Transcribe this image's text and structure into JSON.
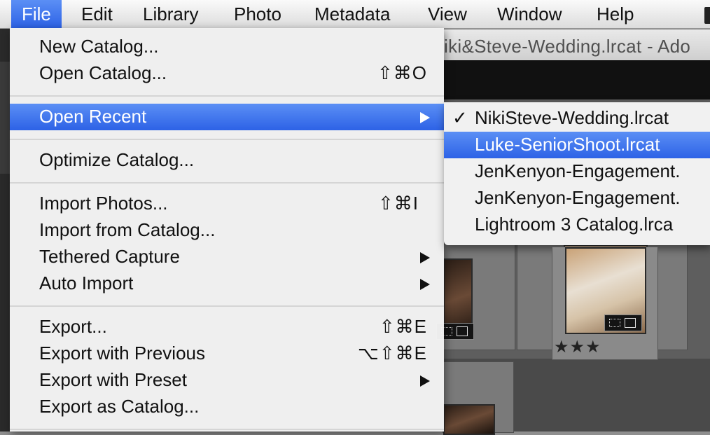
{
  "menubar": {
    "items": [
      "File",
      "Edit",
      "Library",
      "Photo",
      "Metadata",
      "View",
      "Window",
      "Help"
    ],
    "active": "File"
  },
  "window": {
    "title": "iki&Steve-Wedding.lrcat - Ado"
  },
  "file_menu": {
    "items": [
      {
        "label": "New Catalog...",
        "shortcut": ""
      },
      {
        "label": "Open Catalog...",
        "shortcut": "⇧⌘O"
      },
      {
        "label": "Open Recent",
        "submenu": true,
        "highlighted": true
      },
      {
        "label": "Optimize Catalog...",
        "shortcut": ""
      },
      {
        "label": "Import Photos...",
        "shortcut": "⇧⌘I"
      },
      {
        "label": "Import from Catalog...",
        "shortcut": ""
      },
      {
        "label": "Tethered Capture",
        "submenu": true
      },
      {
        "label": "Auto Import",
        "submenu": true
      },
      {
        "label": "Export...",
        "shortcut": "⇧⌘E"
      },
      {
        "label": "Export with Previous",
        "shortcut": "⌥⇧⌘E"
      },
      {
        "label": "Export with Preset",
        "submenu": true
      },
      {
        "label": "Export as Catalog...",
        "shortcut": ""
      }
    ]
  },
  "open_recent_submenu": {
    "check_mark": "✓",
    "items": [
      {
        "label": "NikiSteve-Wedding.lrcat",
        "checked": true
      },
      {
        "label": "Luke-SeniorShoot.lrcat",
        "highlighted": true
      },
      {
        "label": "JenKenyon-Engagement."
      },
      {
        "label": "JenKenyon-Engagement."
      },
      {
        "label": "Lightroom 3 Catalog.lrca"
      }
    ]
  },
  "grid": {
    "rating_label_a": "★★★",
    "rating_label_b": "★★★"
  },
  "colors": {
    "highlight": "#3a6ff0",
    "menu_bg": "#f4f4f4"
  }
}
